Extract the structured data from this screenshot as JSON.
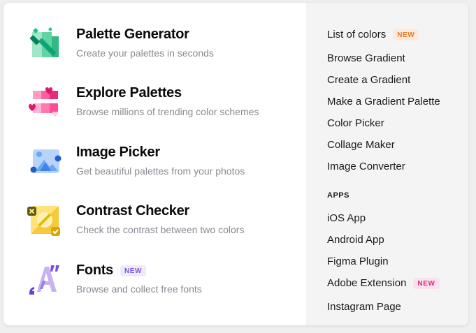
{
  "tools": [
    {
      "title": "Palette Generator",
      "description": "Create your palettes in seconds",
      "icon": "magic-wand-icon"
    },
    {
      "title": "Explore Palettes",
      "description": "Browse millions of trending color schemes",
      "icon": "palettes-hearts-icon"
    },
    {
      "title": "Image Picker",
      "description": "Get beautiful palettes from your photos",
      "icon": "image-picker-icon"
    },
    {
      "title": "Contrast Checker",
      "description": "Check the contrast between two colors",
      "icon": "contrast-check-icon"
    },
    {
      "title": "Fonts",
      "description": "Browse and collect free fonts",
      "badge": "NEW",
      "icon": "fonts-icon"
    }
  ],
  "links": {
    "list_of_colors": {
      "label": "List of colors",
      "badge": "NEW"
    },
    "browse_gradient": "Browse Gradient",
    "create_gradient": "Create a Gradient",
    "make_gradient_palette": "Make a Gradient Palette",
    "color_picker": "Color Picker",
    "collage_maker": "Collage Maker",
    "image_converter": "Image Converter"
  },
  "apps": {
    "heading": "APPS",
    "ios": "iOS App",
    "android": "Android App",
    "figma": "Figma Plugin",
    "adobe": {
      "label": "Adobe Extension",
      "badge": "NEW"
    },
    "instagram": "Instagram Page"
  },
  "colors": {
    "badge_purple": "#7a57dd",
    "badge_orange": "#e77a2a",
    "badge_pink": "#d8307c",
    "right_panel_bg": "#f4f4f5"
  }
}
